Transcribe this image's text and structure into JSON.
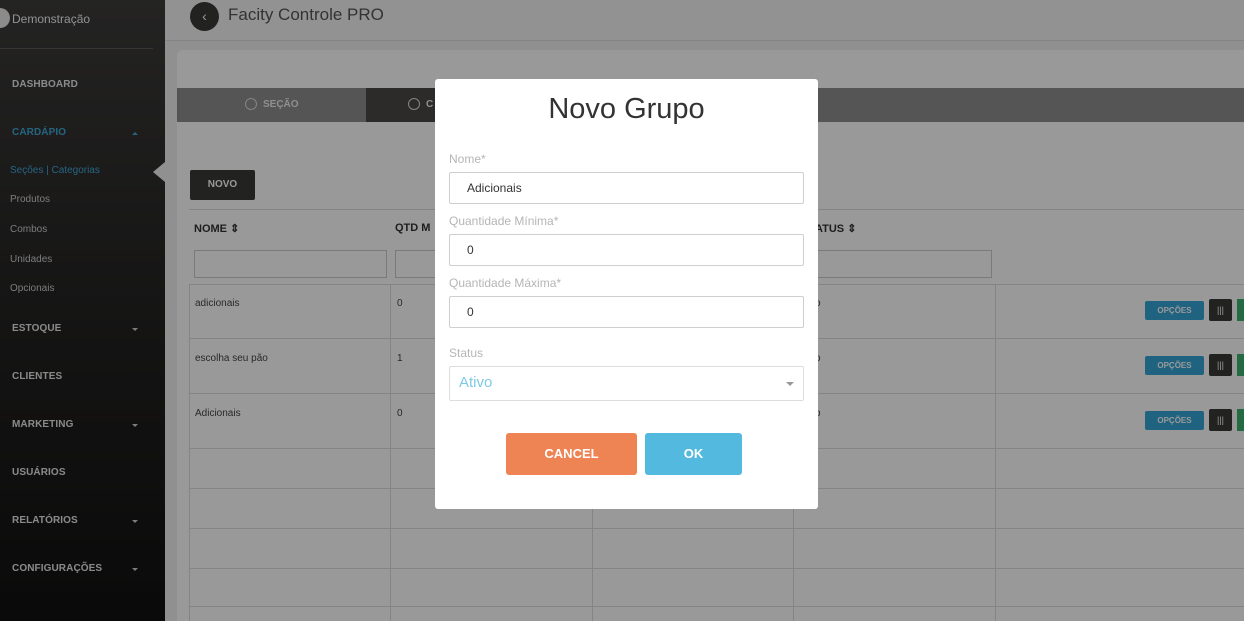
{
  "sidebar": {
    "user_name": "Demonstração",
    "items": {
      "dashboard": "DASHBOARD",
      "cardapio": "CARDÁPIO",
      "estoque": "ESTOQUE",
      "clientes": "CLIENTES",
      "marketing": "MARKETING",
      "usuarios": "USUÁRIOS",
      "relatorios": "RELATÓRIOS",
      "configuracoes": "CONFIGURAÇÕES"
    },
    "cardapio_sub": {
      "secoes": "Seções | Categorias",
      "produtos": "Produtos",
      "combos": "Combos",
      "unidades": "Unidades",
      "opcionais": "Opcionais"
    },
    "active_color": "#3fa9d9"
  },
  "header": {
    "title": "Facity Controle PRO",
    "back_icon": "chevron-left-icon"
  },
  "tabs": {
    "secao": "SEÇÃO",
    "second": "C"
  },
  "toolbar": {
    "novo": "NOVO"
  },
  "table": {
    "headers": {
      "nome": "NOME",
      "qtd": "QTD M",
      "status": "ATUS"
    },
    "sort_glyph": "⇕",
    "rows": [
      {
        "nome": "adicionais",
        "qtd": "0",
        "status": "o"
      },
      {
        "nome": "escolha seu pão",
        "qtd": "1",
        "status": "o"
      },
      {
        "nome": "Adicionais",
        "qtd": "0",
        "status": "o"
      }
    ],
    "opcoes_label": "OPÇÕES",
    "grid_icon": "columns-icon"
  },
  "modal": {
    "title": "Novo Grupo",
    "nome_label": "Nome*",
    "nome_value": "Adicionais",
    "qmin_label": "Quantidade Mínima*",
    "qmin_value": "0",
    "qmax_label": "Quantidade Máxima*",
    "qmax_value": "0",
    "status_label": "Status",
    "status_value": "Ativo",
    "cancel_label": "CANCEL",
    "ok_label": "OK",
    "cancel_color": "#ee8354",
    "ok_color": "#53b9df"
  }
}
